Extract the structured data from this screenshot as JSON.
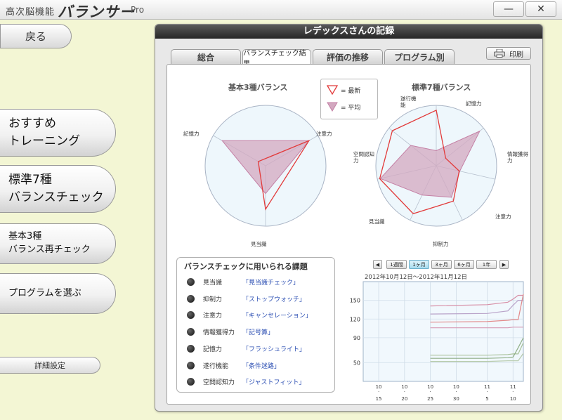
{
  "titlebar": {
    "app_title": "高次脳機能",
    "brand": "バランサー",
    "edition": "Pro",
    "minimize_label": "—",
    "close_label": "✕"
  },
  "nav": {
    "back_label": "戻る",
    "items": [
      {
        "label": "おすすめ\nトレーニング"
      },
      {
        "label": "標準7種\nバランスチェック"
      },
      {
        "label": "基本3種\nバランス再チェック"
      },
      {
        "label": "プログラムを選ぶ"
      }
    ],
    "settings_label": "詳細設定"
  },
  "panel": {
    "title": "レデックスさんの記録",
    "tabs": [
      {
        "label": "総合"
      },
      {
        "label": "バランスチェック結果"
      },
      {
        "label": "評価の推移"
      },
      {
        "label": "プログラム別"
      }
    ],
    "active_tab": 1,
    "print_label": "印刷",
    "print_icon": "printer-icon"
  },
  "legend": {
    "latest": "= 最新",
    "average": "= 平均"
  },
  "colors": {
    "latest_stroke": "#e23a3a",
    "average_fill": "#d3a8c0",
    "average_stroke": "#c47fa4",
    "page_bg": "#f3f6d4"
  },
  "basic3": {
    "title": "基本3種バランス",
    "axes": [
      "注意力",
      "見当識",
      "記憶力"
    ],
    "latest": [
      0.83,
      0.72,
      0.14
    ],
    "average": [
      0.83,
      0.46,
      0.83
    ]
  },
  "standard7": {
    "title": "標準7種バランス",
    "axes": [
      "記憶力",
      "情報獲得力",
      "注意力",
      "抑制力",
      "見当識",
      "空間認知力",
      "遂行機能"
    ],
    "latest": [
      0.2,
      0.39,
      0.65,
      0.88,
      0.96,
      0.93,
      0.92
    ],
    "average": [
      0.92,
      0.4,
      0.58,
      0.54,
      0.95,
      0.54,
      0.25
    ]
  },
  "tasks": {
    "title": "バランスチェックに用いられる課題",
    "rows": [
      {
        "name": "見当識",
        "game": "「見当識チェック」"
      },
      {
        "name": "抑制力",
        "game": "「ストップウォッチ」"
      },
      {
        "name": "注意力",
        "game": "「キャンセレーション」"
      },
      {
        "name": "情報獲得力",
        "game": "「記号算」"
      },
      {
        "name": "記憶力",
        "game": "「フラッシュライト」"
      },
      {
        "name": "遂行機能",
        "game": "「条件迷路」"
      },
      {
        "name": "空間認知力",
        "game": "「ジャストフィット」"
      }
    ]
  },
  "trend": {
    "prev_label": "◀",
    "next_label": "▶",
    "ranges": [
      "1週間",
      "1ヶ月",
      "3ヶ月",
      "6ヶ月",
      "1年"
    ],
    "active_range": 1,
    "date_range": "2012年10月12日～2012年11月12日"
  },
  "chart_data": {
    "type": "line",
    "ylim": [
      20,
      180
    ],
    "yticks": [
      150,
      120,
      90,
      50
    ],
    "xticks": [
      {
        "month": "10",
        "day": "15"
      },
      {
        "month": "10",
        "day": "20"
      },
      {
        "month": "10",
        "day": "25"
      },
      {
        "month": "10",
        "day": "30"
      },
      {
        "month": "11",
        "day": "5"
      },
      {
        "month": "11",
        "day": "10"
      }
    ],
    "x_dates": [
      "10/25",
      "11/5",
      "11/9",
      "11/10",
      "11/11",
      "11/12"
    ],
    "series": [
      {
        "color": "#b9a3c9",
        "values": [
          128,
          129,
          133,
          142,
          150,
          150
        ]
      },
      {
        "color": "#d78fa7",
        "values": [
          141,
          143,
          147,
          152,
          158,
          158
        ]
      },
      {
        "color": "#e28888",
        "values": [
          115,
          116,
          118,
          119,
          119,
          160
        ]
      },
      {
        "color": "#d69ab5",
        "values": [
          106,
          106,
          106,
          107,
          107,
          107
        ]
      },
      {
        "color": "#a9c29a",
        "values": [
          62,
          62,
          63,
          64,
          64,
          82
        ]
      },
      {
        "color": "#8fae86",
        "values": [
          57,
          57,
          58,
          59,
          74,
          90
        ]
      },
      {
        "color": "#b5c9aa",
        "values": [
          52,
          52,
          53,
          53,
          53,
          65
        ]
      }
    ]
  }
}
